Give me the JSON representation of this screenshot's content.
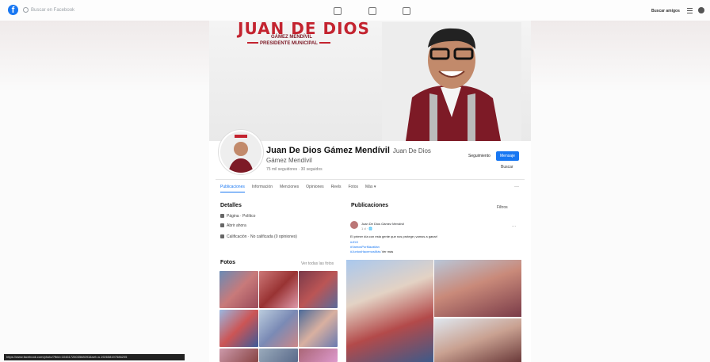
{
  "topbar": {
    "search_placeholder": "Buscar en Facebook",
    "right_label": "Buscar amigos"
  },
  "cover": {
    "title": "JUAN DE DIOS",
    "subtitle1": "GÁMEZ MENDÍVIL",
    "subtitle2": "PRESIDENTE MUNICIPAL"
  },
  "profile": {
    "name": "Juan De Dios Gámez Mendívil",
    "alt_name": "Juan De Dios",
    "alt_name_2": "Gámez Mendívil",
    "followers": "75 mil seguidores · 30 seguidos",
    "follow_label": "Seguimiento",
    "message_label": "Mensaje",
    "search_label": "Buscar"
  },
  "tabs": [
    {
      "label": "Publicaciones",
      "active": true
    },
    {
      "label": "Información",
      "active": false
    },
    {
      "label": "Menciones",
      "active": false
    },
    {
      "label": "Opiniones",
      "active": false
    },
    {
      "label": "Reels",
      "active": false
    },
    {
      "label": "Fotos",
      "active": false
    },
    {
      "label": "Más ▾",
      "active": false
    }
  ],
  "tab_more": "···",
  "detalles": {
    "title": "Detalles",
    "rows": [
      "Página · Político",
      "Abrir ahora",
      "Calificación · No calificada (0 opiniones)"
    ]
  },
  "fotos": {
    "title": "Fotos",
    "link": "Ver todas las fotos"
  },
  "posts": {
    "title": "Publicaciones",
    "filters_label": "Filtros",
    "author": "Juan De Dios Gámez Mendívil",
    "time": "1 d · 🌐",
    "text": "El primer día con esta gente que nos protege ¡vamos a ganar!",
    "link1": "#JDG",
    "link2": "#VamosPorMazatlán",
    "link3": "#JuntosHacemosMás",
    "more": "Ver más",
    "dots": "···"
  },
  "statusbar": {
    "url": "https://www.facebook.com/photo/?fbid=1046172603568093&set=a.192658197586205"
  },
  "colors": {
    "brand_blue": "#1877f2",
    "cover_red": "#c3232f",
    "vest_maroon": "#7d1a26"
  }
}
